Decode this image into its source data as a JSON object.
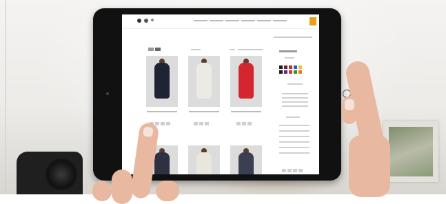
{
  "scene": {
    "colors": {
      "tablet_body": "#111111",
      "accent_badge": "#e8a01a",
      "skin": "#e8b9a0"
    }
  },
  "products": [
    {
      "dress_color": "#1e2433"
    },
    {
      "dress_color": "#eceae4"
    },
    {
      "dress_color": "#d4262f"
    },
    {
      "dress_color": "#2d3142"
    },
    {
      "dress_color": "#e9e6dc"
    },
    {
      "dress_color": "#3a4052"
    }
  ],
  "swatches": [
    "#1c1c1c",
    "#7a1f2b",
    "#c82b2b",
    "#2a5db0",
    "#e8c12a",
    "#1c1c1c",
    "#5c2e8c",
    "#d23a3a",
    "#3c8a3c",
    "#e07b1a"
  ]
}
